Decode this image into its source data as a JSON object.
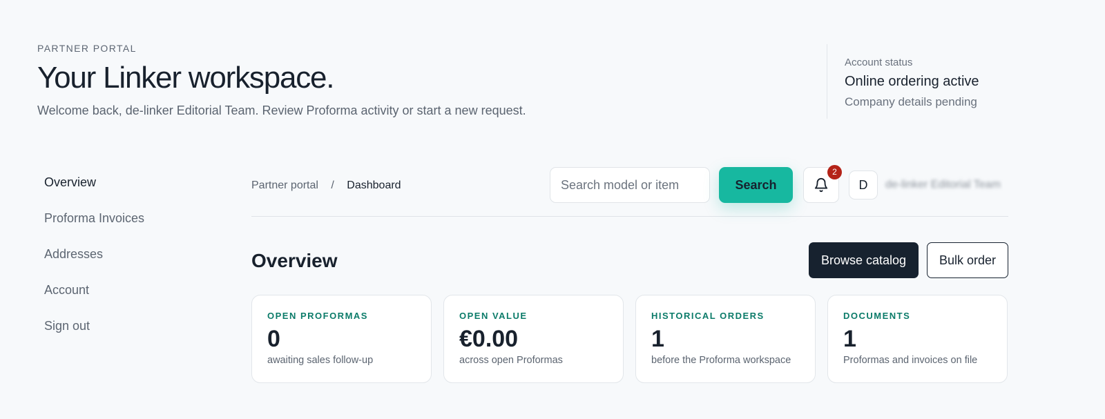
{
  "hero": {
    "eyebrow": "PARTNER PORTAL",
    "title": "Your Linker workspace.",
    "subtitle": "Welcome back, de-linker Editorial Team. Review Proforma activity or start a new request."
  },
  "account_status": {
    "label": "Account status",
    "value": "Online ordering active",
    "note": "Company details pending"
  },
  "sidebar": {
    "items": [
      {
        "label": "Overview",
        "active": true
      },
      {
        "label": "Proforma Invoices",
        "active": false
      },
      {
        "label": "Addresses",
        "active": false
      },
      {
        "label": "Account",
        "active": false
      },
      {
        "label": "Sign out",
        "active": false
      }
    ]
  },
  "topbar": {
    "breadcrumb": {
      "root": "Partner portal",
      "separator": "/",
      "current": "Dashboard"
    },
    "search": {
      "placeholder": "Search model or item",
      "value": "",
      "button_label": "Search"
    },
    "notifications": {
      "icon": "bell-icon",
      "count": "2"
    },
    "user": {
      "initial": "D",
      "name": "de-linker Editorial Team"
    }
  },
  "main": {
    "section_title": "Overview",
    "actions": {
      "browse": "Browse catalog",
      "bulk": "Bulk order"
    },
    "cards": [
      {
        "label": "OPEN PROFORMAS",
        "value": "0",
        "desc": "awaiting sales follow-up"
      },
      {
        "label": "OPEN VALUE",
        "value": "€0.00",
        "desc": "across open Proformas"
      },
      {
        "label": "HISTORICAL ORDERS",
        "value": "1",
        "desc": "before the Proforma workspace"
      },
      {
        "label": "DOCUMENTS",
        "value": "1",
        "desc": "Proformas and invoices on file"
      }
    ]
  },
  "colors": {
    "accent": "#17b8a0",
    "accent_text": "#0b7b69",
    "dark": "#17222f",
    "badge": "#b42318",
    "background": "#f7f9fb"
  }
}
